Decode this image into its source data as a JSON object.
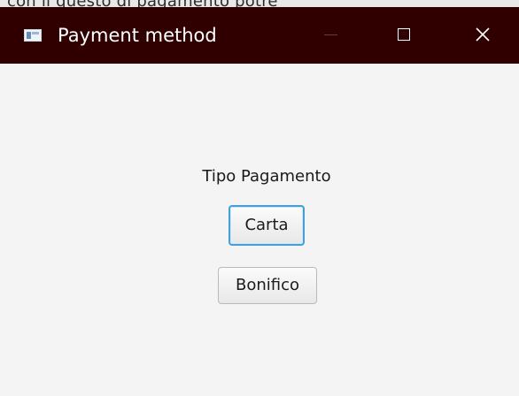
{
  "background_text": "con il questo di pagamento potre",
  "window": {
    "title": "Payment method"
  },
  "titlebar_controls": {
    "minimize": "minimize-icon",
    "maximize": "maximize-icon",
    "close": "close-icon"
  },
  "payment": {
    "label": "Tipo Pagamento",
    "card_button": "Carta",
    "transfer_button": "Bonifico"
  },
  "colors": {
    "titlebar_background": "#300000",
    "titlebar_text": "#ffffff",
    "content_background": "#f4f4f4",
    "focus_border": "#43a0d8"
  }
}
